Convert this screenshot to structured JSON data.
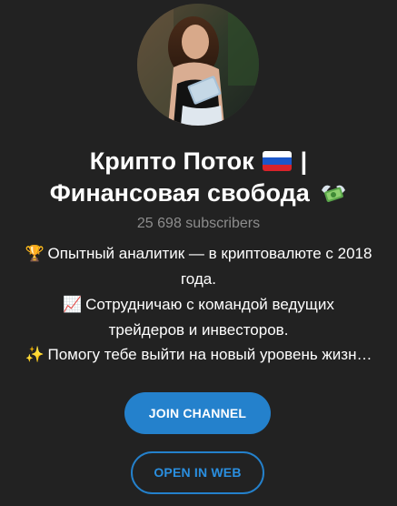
{
  "channel": {
    "title_line1": "Крипто Поток",
    "title_separator": "|",
    "title_line2": "Финансовая свобода",
    "flag_icon": "russian-flag-icon",
    "money_icon": "money-with-wings-icon",
    "subscribers": "25 698 subscribers"
  },
  "description": {
    "line1_emoji": "🏆",
    "line1": "Опытный аналитик — в криптовалюте с 2018",
    "line2": "года.",
    "line3_emoji": "📈",
    "line3": "Сотрудничаю с командой ведущих",
    "line4": "трейдеров и инвесторов.",
    "line5_emoji": "✨",
    "line5": "Помогу тебе выйти на новый уровень жизн…"
  },
  "buttons": {
    "join_label": "JOIN CHANNEL",
    "web_label": "OPEN IN WEB"
  },
  "colors": {
    "background": "#222222",
    "accent": "#2481cc",
    "muted_text": "#8d8d8d"
  }
}
